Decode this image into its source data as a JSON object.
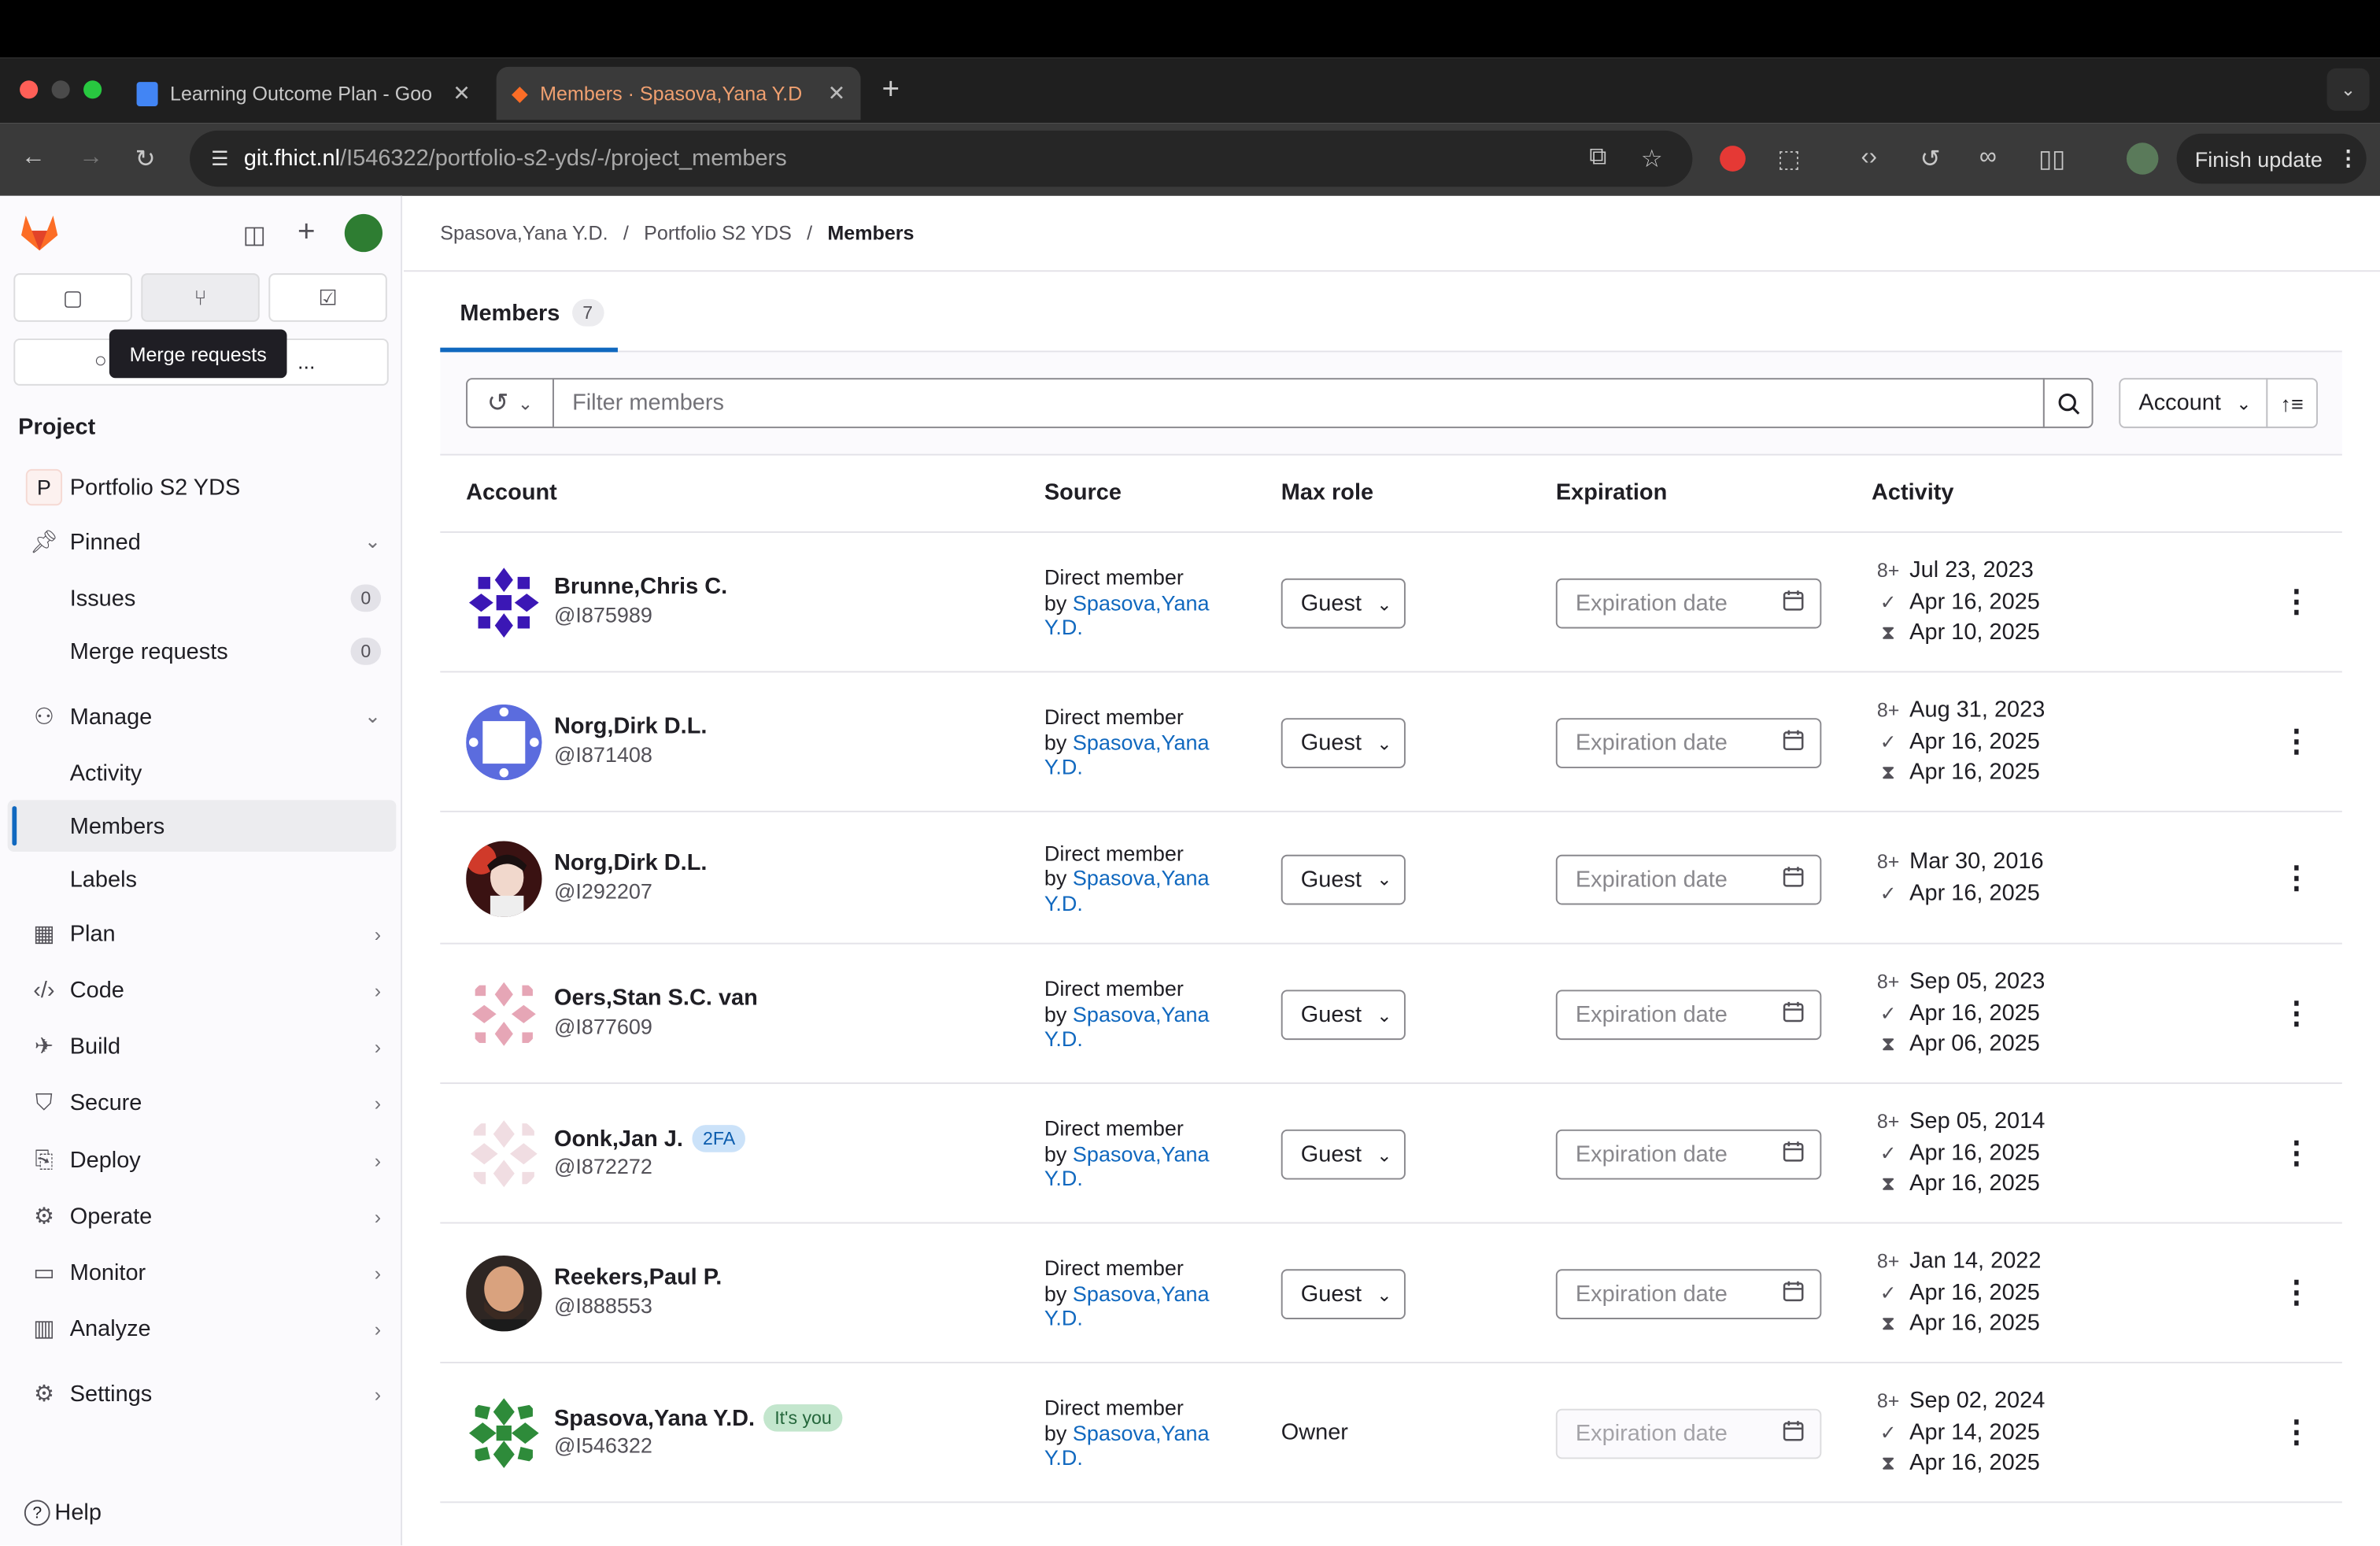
{
  "browser": {
    "tabs": [
      {
        "title": "Learning Outcome Plan - Goo",
        "icon": "google-docs-icon",
        "active": false
      },
      {
        "title": "Members · Spasova,Yana Y.D",
        "icon": "gitlab-icon",
        "active": true
      }
    ],
    "url_host": "git.fhict.nl",
    "url_path": "/I546322/portfolio-s2-yds/-/project_members",
    "finish_update": "Finish update"
  },
  "sidebar": {
    "tooltip": "Merge requests",
    "search_suffix": "...",
    "section": "Project",
    "project_initial": "P",
    "project_name": "Portfolio S2 YDS",
    "items": [
      {
        "label": "Pinned"
      },
      {
        "label": "Issues",
        "count": "0"
      },
      {
        "label": "Merge requests",
        "count": "0"
      },
      {
        "label": "Manage"
      },
      {
        "label": "Activity"
      },
      {
        "label": "Members"
      },
      {
        "label": "Labels"
      },
      {
        "label": "Plan"
      },
      {
        "label": "Code"
      },
      {
        "label": "Build"
      },
      {
        "label": "Secure"
      },
      {
        "label": "Deploy"
      },
      {
        "label": "Operate"
      },
      {
        "label": "Monitor"
      },
      {
        "label": "Analyze"
      },
      {
        "label": "Settings"
      }
    ],
    "help": "Help"
  },
  "breadcrumb": [
    "Spasova,Yana Y.D.",
    "Portfolio S2 YDS",
    "Members"
  ],
  "tabs": {
    "members_label": "Members",
    "members_count": "7"
  },
  "filter": {
    "placeholder": "Filter members",
    "sort_label": "Account"
  },
  "table": {
    "headers": [
      "Account",
      "Source",
      "Max role",
      "Expiration",
      "Activity"
    ],
    "source_prefix": "Direct member",
    "source_by": "by",
    "source_link_1": "Spasova,Yana",
    "source_link_2": "Y.D.",
    "expiration_placeholder": "Expiration date",
    "rows": [
      {
        "name": "Brunne,Chris C.",
        "handle": "@I875989",
        "role": "Guest",
        "joined": "Jul 23, 2023",
        "last_activity": "Apr 16, 2025",
        "expires": "Apr 10, 2025"
      },
      {
        "name": "Norg,Dirk D.L.",
        "handle": "@I871408",
        "role": "Guest",
        "joined": "Aug 31, 2023",
        "last_activity": "Apr 16, 2025",
        "expires": "Apr 16, 2025"
      },
      {
        "name": "Norg,Dirk D.L.",
        "handle": "@I292207",
        "role": "Guest",
        "joined": "Mar 30, 2016",
        "last_activity": "Apr 16, 2025"
      },
      {
        "name": "Oers,Stan S.C. van",
        "handle": "@I877609",
        "role": "Guest",
        "joined": "Sep 05, 2023",
        "last_activity": "Apr 16, 2025",
        "expires": "Apr 06, 2025"
      },
      {
        "name": "Oonk,Jan J.",
        "badge": "2FA",
        "handle": "@I872272",
        "role": "Guest",
        "joined": "Sep 05, 2014",
        "last_activity": "Apr 16, 2025",
        "expires": "Apr 16, 2025"
      },
      {
        "name": "Reekers,Paul P.",
        "handle": "@I888553",
        "role": "Guest",
        "joined": "Jan 14, 2022",
        "last_activity": "Apr 16, 2025",
        "expires": "Apr 16, 2025"
      },
      {
        "name": "Spasova,Yana Y.D.",
        "badge": "It's you",
        "handle": "@I546322",
        "role": "Owner",
        "joined": "Sep 02, 2024",
        "last_activity": "Apr 14, 2025",
        "expires": "Apr 16, 2025"
      }
    ]
  },
  "colors": {
    "accent": "#1068bf",
    "link": "#1068bf",
    "gitlab_orange": "#fc6d26"
  }
}
